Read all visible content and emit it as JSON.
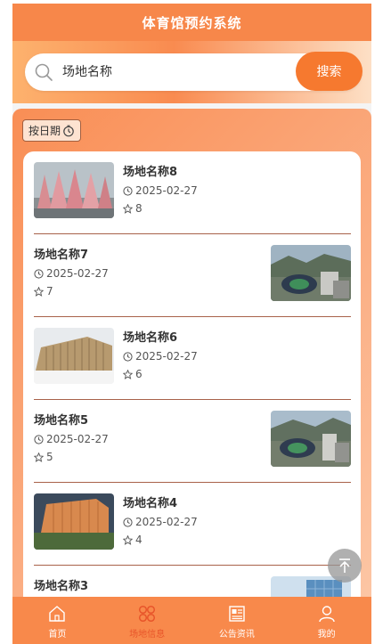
{
  "header": {
    "title": "体育馆预约系统"
  },
  "search": {
    "value": "场地名称",
    "button_label": "搜索"
  },
  "filter": {
    "date_button_label": "按日期"
  },
  "venues": [
    {
      "name": "场地名称8",
      "date": "2025-02-27",
      "likes": "8",
      "image": "pink-pavilion"
    },
    {
      "name": "场地名称7",
      "date": "2025-02-27",
      "likes": "7",
      "image": "stadium-aerial"
    },
    {
      "name": "场地名称6",
      "date": "2025-02-27",
      "likes": "6",
      "image": "wooden-hall"
    },
    {
      "name": "场地名称5",
      "date": "2025-02-27",
      "likes": "5",
      "image": "stadium-aerial"
    },
    {
      "name": "场地名称4",
      "date": "2025-02-27",
      "likes": "4",
      "image": "orange-hall"
    },
    {
      "name": "场地名称3",
      "date": "",
      "likes": "",
      "image": "blue-building"
    }
  ],
  "tabbar": {
    "items": [
      {
        "label": "首页",
        "icon": "home-icon"
      },
      {
        "label": "场地信息",
        "icon": "grid-icon",
        "active": true
      },
      {
        "label": "公告资讯",
        "icon": "news-icon"
      },
      {
        "label": "我的",
        "icon": "user-icon"
      }
    ]
  },
  "colors": {
    "accent": "#f6792f",
    "tab_bg": "#f8894b",
    "active_tab": "#e8552a"
  }
}
